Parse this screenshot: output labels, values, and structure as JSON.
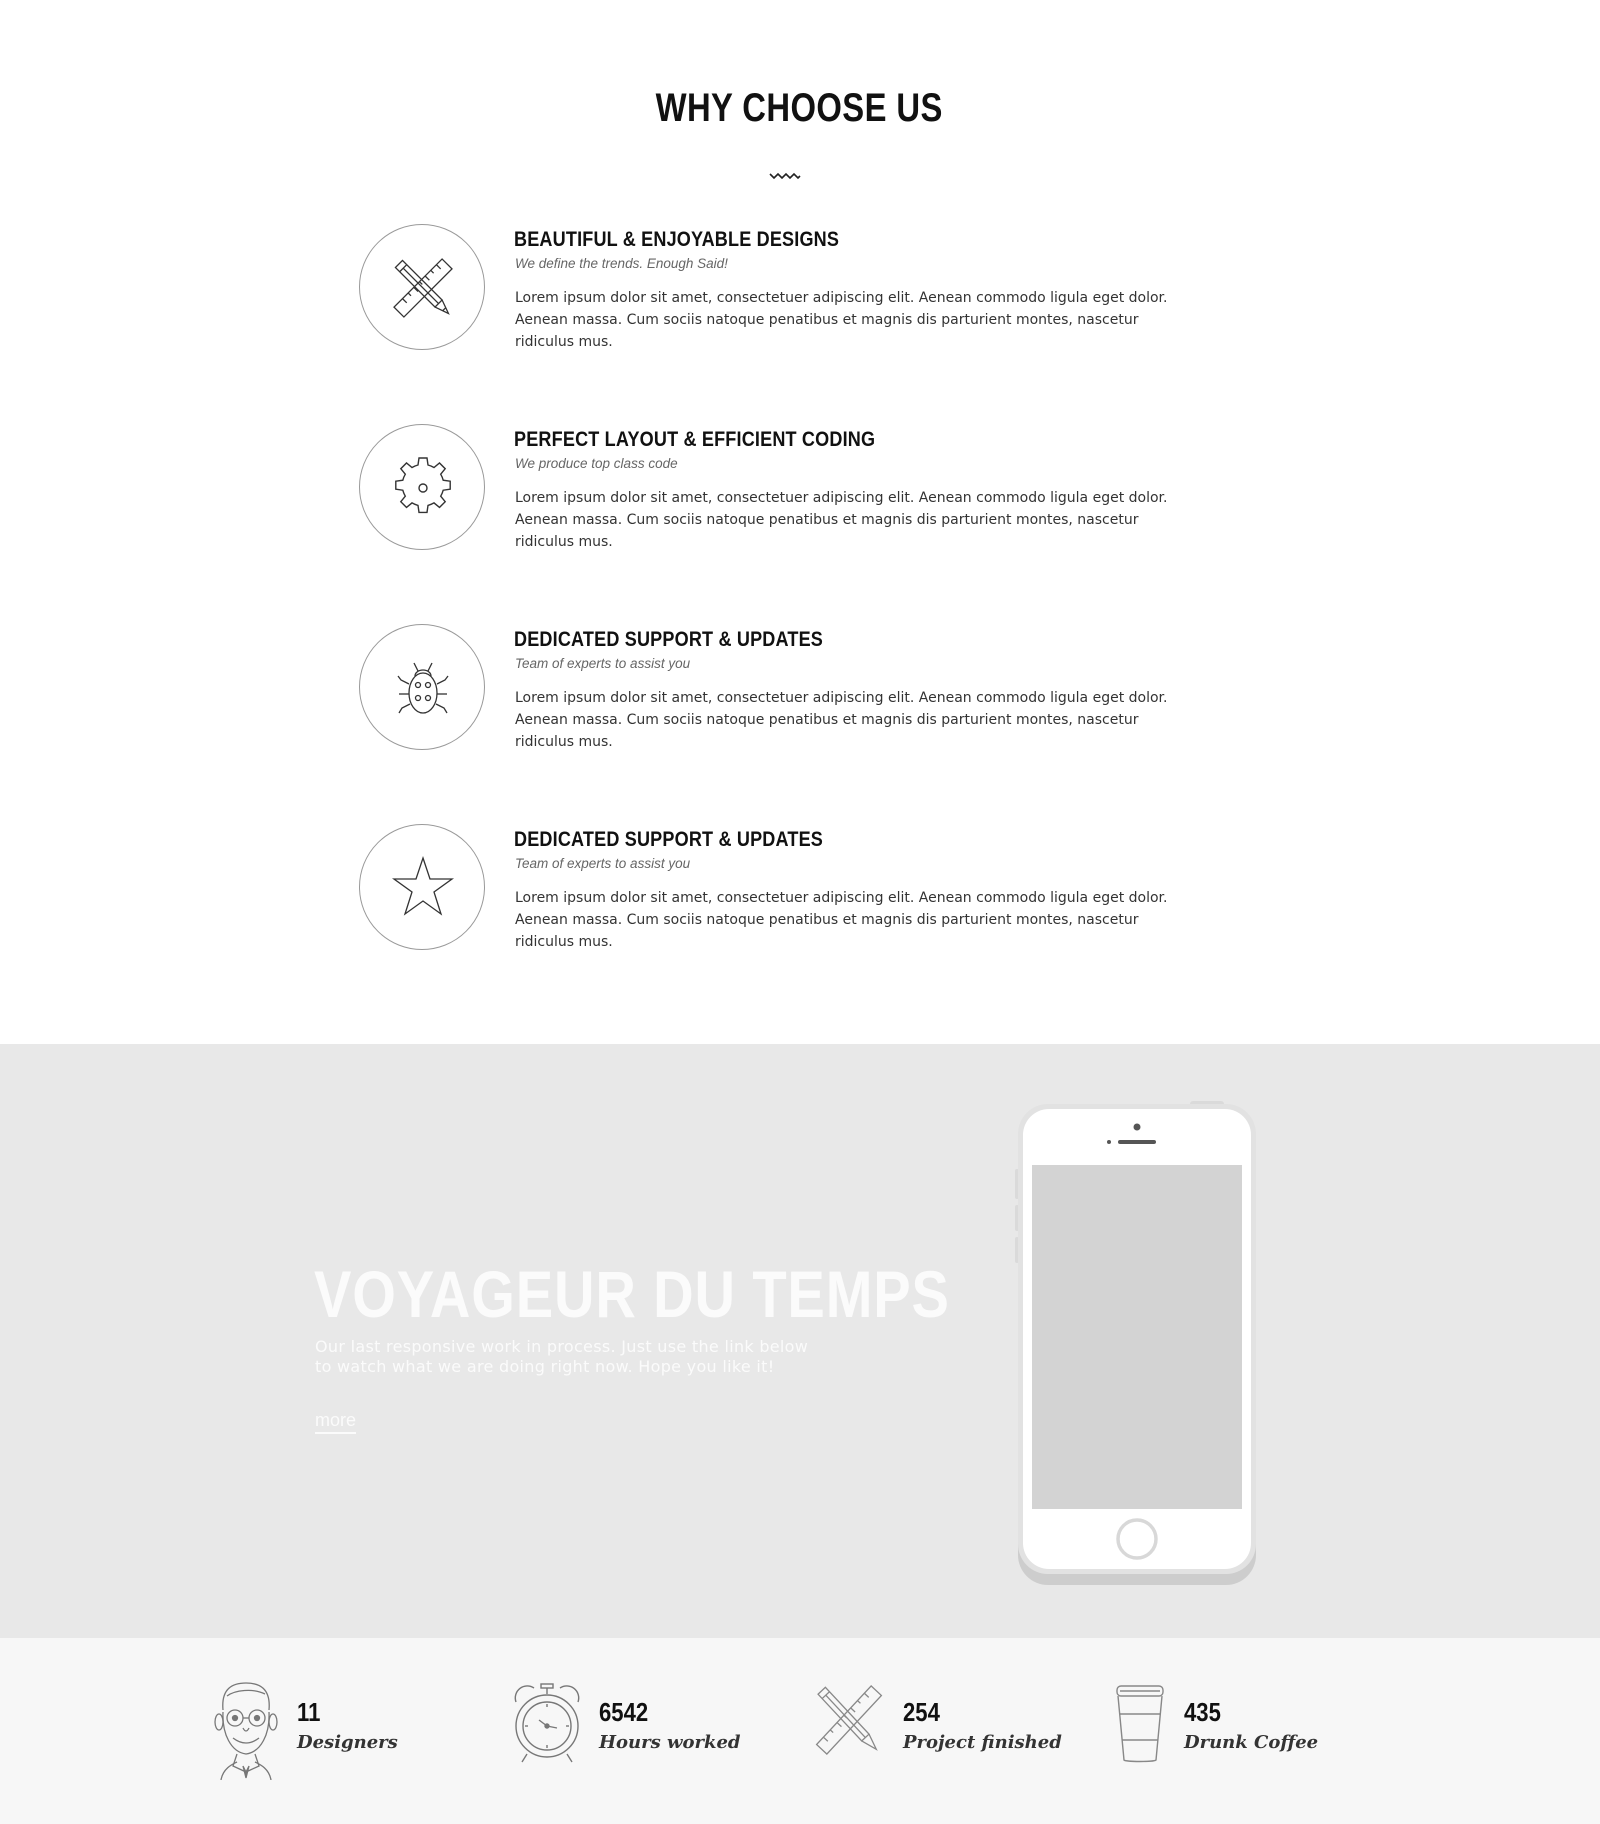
{
  "why": {
    "title": "WHY CHOOSE US",
    "features": [
      {
        "icon": "pencil-ruler-icon",
        "title": "BEAUTIFUL & ENJOYABLE DESIGNS",
        "subtitle": "We define the trends. Enough Said!",
        "text": "Lorem ipsum dolor sit amet, consectetuer adipiscing elit. Aenean commodo ligula eget dolor. Aenean massa. Cum sociis natoque penatibus et magnis dis parturient montes, nascetur ridiculus mus."
      },
      {
        "icon": "gear-icon",
        "title": "PERFECT LAYOUT & EFFICIENT CODING",
        "subtitle": "We produce top class code",
        "text": "Lorem ipsum dolor sit amet, consectetuer adipiscing elit. Aenean commodo ligula eget dolor. Aenean massa. Cum sociis natoque penatibus et magnis dis parturient montes, nascetur ridiculus mus."
      },
      {
        "icon": "bug-icon",
        "title": "DEDICATED SUPPORT & UPDATES",
        "subtitle": "Team of experts to assist you",
        "text": "Lorem ipsum dolor sit amet, consectetuer adipiscing elit. Aenean commodo ligula eget dolor. Aenean massa. Cum sociis natoque penatibus et magnis dis parturient montes, nascetur ridiculus mus."
      },
      {
        "icon": "star-icon",
        "title": "DEDICATED SUPPORT & UPDATES",
        "subtitle": "Team of experts to assist you",
        "text": "Lorem ipsum dolor sit amet, consectetuer adipiscing elit. Aenean commodo ligula eget dolor. Aenean massa. Cum sociis natoque penatibus et magnis dis parturient montes, nascetur ridiculus mus."
      }
    ]
  },
  "promo": {
    "title": "VOYAGEUR DU TEMPS",
    "text_line1": "Our last responsive work in process. Just use the link below",
    "text_line2": "to watch what we are doing right now. Hope you like it!",
    "more_label": "more",
    "background_color": "#e8e8e8",
    "phone_icon": "smartphone-icon"
  },
  "stats": [
    {
      "icon": "designer-face-icon",
      "value": "11",
      "label": "Designers"
    },
    {
      "icon": "alarm-clock-icon",
      "value": "6542",
      "label": "Hours worked"
    },
    {
      "icon": "pencil-ruler-icon",
      "value": "254",
      "label": "Project finished"
    },
    {
      "icon": "coffee-cup-icon",
      "value": "435",
      "label": "Drunk Coffee"
    }
  ]
}
